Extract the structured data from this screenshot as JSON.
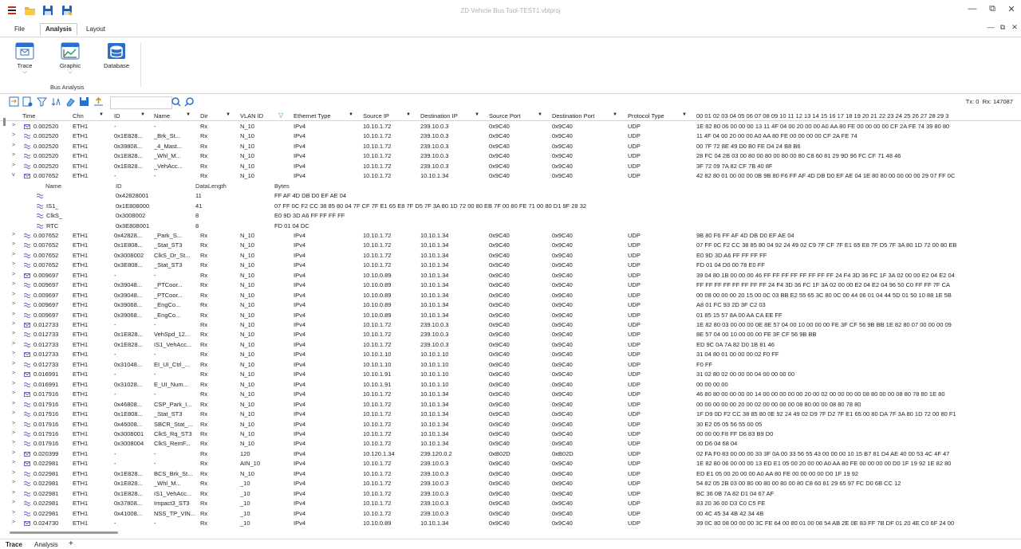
{
  "window": {
    "title": "ZD Vehicle Bus Tool-TEST1.vbtproj",
    "controls": [
      "—",
      "⧉",
      "✕"
    ],
    "doc_controls": [
      "—",
      "⧉",
      "✕"
    ]
  },
  "quick_access": [
    "app-logo-icon",
    "open-folder-icon",
    "save-icon",
    "save-as-icon"
  ],
  "menu": {
    "tabs": [
      "File",
      "Analysis",
      "Layout"
    ],
    "active": "Analysis"
  },
  "ribbon": {
    "buttons": [
      {
        "label": "Trace",
        "icon": "trace-window-icon",
        "has_dropdown": true
      },
      {
        "label": "Graphic",
        "icon": "graphic-chart-icon",
        "has_dropdown": true
      },
      {
        "label": "Database",
        "icon": "database-icon",
        "has_dropdown": false
      }
    ],
    "group_label": "Bus Analysis"
  },
  "toolbar": {
    "icons": [
      "export-icon",
      "import-icon",
      "filter-icon",
      "sort-icon",
      "clear-icon",
      "save-trace-icon",
      "upload-icon"
    ],
    "search_placeholder": "",
    "search_icons": [
      "search-next-icon",
      "search-prev-icon"
    ],
    "tx_label": "Tx: 0",
    "rx_label": "Rx: 147087"
  },
  "columns": [
    "Time",
    "Chn",
    "ID",
    "Name",
    "Dir",
    "VLAN ID",
    "Ethernet Type",
    "Source IP",
    "Destination IP",
    "Source Port",
    "Destination Port",
    "Protocol Type",
    "00 01 02 03 04 05 06 07 08 09 10 11 12 13 14 15 16 17 18 19 20 21 22 23 24 25 26 27 28 29 3"
  ],
  "rows_before": [
    {
      "exp": ">",
      "type": "mail",
      "time": "0.002520",
      "chn": "ETH1",
      "id": "-",
      "name": "-",
      "dir": "Rx",
      "vlan": "N_10",
      "eth": "IPv4",
      "src": "10.10.1.72",
      "dst": "239.10.0.3",
      "sport": "0x9C40",
      "dport": "0x9C40",
      "proto": "UDP",
      "bytes": "1E 82 80 06 00 00 00 13 11 4F 04 00 20 00 00 A0 AA 80 FE 00 00 00 00 CF 2A FE 74 39 80 80"
    },
    {
      "exp": ">",
      "type": "wave",
      "time": "0.002520",
      "chn": "ETH1",
      "id": "0x1E828...",
      "name": "_Brk_St...",
      "dir": "Rx",
      "vlan": "N_10",
      "eth": "IPv4",
      "src": "10.10.1.72",
      "dst": "239.10.0.3",
      "sport": "0x9C40",
      "dport": "0x9C40",
      "proto": "UDP",
      "bytes": "11 4F 04 00 20 00 00 A0 AA 80 FE 00 00 00 00 CF 2A FE 74"
    },
    {
      "exp": ">",
      "type": "wave",
      "time": "0.002520",
      "chn": "ETH1",
      "id": "0x39808...",
      "name": "_4_Mast...",
      "dir": "Rx",
      "vlan": "N_10",
      "eth": "IPv4",
      "src": "10.10.1.72",
      "dst": "239.10.0.3",
      "sport": "0x9C40",
      "dport": "0x9C40",
      "proto": "UDP",
      "bytes": "00 7F 72 8E 49 D0 B0 FE D4 24 B8 B6"
    },
    {
      "exp": ">",
      "type": "wave",
      "time": "0.002520",
      "chn": "ETH1",
      "id": "0x1E828...",
      "name": "_Whl_M...",
      "dir": "Rx",
      "vlan": "N_10",
      "eth": "IPv4",
      "src": "10.10.1.72",
      "dst": "239.10.0.3",
      "sport": "0x9C40",
      "dport": "0x9C40",
      "proto": "UDP",
      "bytes": "28 FC 04 2B 03 00 80 00 80 00 80 00 80 C8 60 81 29 9D 96 FC CF 71 48 46"
    },
    {
      "exp": ">",
      "type": "wave",
      "time": "0.002520",
      "chn": "ETH1",
      "id": "0x1E828...",
      "name": "_VehAcc...",
      "dir": "Rx",
      "vlan": "N_10",
      "eth": "IPv4",
      "src": "10.10.1.72",
      "dst": "239.10.0.3",
      "sport": "0x9C40",
      "dport": "0x9C40",
      "proto": "UDP",
      "bytes": "3F 72 09 7A 82 CF 7B 40 8F"
    },
    {
      "exp": "v",
      "type": "mail",
      "time": "0.007652",
      "chn": "ETH1",
      "id": "-",
      "name": "-",
      "dir": "Rx",
      "vlan": "N_10",
      "eth": "IPv4",
      "src": "10.10.1.72",
      "dst": "10.10.1.34",
      "sport": "0x9C40",
      "dport": "0x9C40",
      "proto": "UDP",
      "bytes": "42 82 80 01 00 00 00 0B 9B 80 F6 FF AF 4D DB D0 EF AE 04 1E 80 80 00 00 00 00 29 07 FF 0C"
    }
  ],
  "sub_header": {
    "name": "Name",
    "id": "ID",
    "len": "DataLength",
    "bytes": "Bytes"
  },
  "sub_rows": [
    {
      "name": "",
      "id": "0x42828001",
      "len": "11",
      "bytes": "FF AF 4D DB D0 EF AE 04"
    },
    {
      "name": "IS1_",
      "id": "0x1E808000",
      "len": "41",
      "bytes": "07 FF 0C F2 CC 38 85 80 04  7F CF 7F E1 65 E8 7F D5 7F 3A 80 1D 72 00 80 EB 7F 00 80 FE 71 00 80 D1 9F 28 32"
    },
    {
      "name": "ClkS_",
      "id": "0x3008002",
      "len": "8",
      "bytes": "E0 9D 3D A6 FF FF FF FF"
    },
    {
      "name": "RTC",
      "id": "0x3E808001",
      "len": "8",
      "bytes": "FD 01 04 DC"
    }
  ],
  "rows_after": [
    {
      "exp": ">",
      "type": "wave",
      "time": "0.007652",
      "chn": "ETH1",
      "id": "0x42828...",
      "name": "_Park_S...",
      "dir": "Rx",
      "vlan": "N_10",
      "eth": "IPv4",
      "src": "10.10.1.72",
      "dst": "10.10.1.34",
      "sport": "0x9C40",
      "dport": "0x9C40",
      "proto": "UDP",
      "bytes": "9B 80 F6 FF AF 4D DB D0 EF AE 04"
    },
    {
      "exp": ">",
      "type": "wave",
      "time": "0.007652",
      "chn": "ETH1",
      "id": "0x1E808...",
      "name": "_Stat_ST3",
      "dir": "Rx",
      "vlan": "N_10",
      "eth": "IPv4",
      "src": "10.10.1.72",
      "dst": "10.10.1.34",
      "sport": "0x9C40",
      "dport": "0x9C40",
      "proto": "UDP",
      "bytes": "07 FF 0C F2 CC 38 85 80 04 92 24 49 02 C9 7F CF 7F E1 65 E8 7F D5 7F 3A 80 1D 72 00 80 EB"
    },
    {
      "exp": ">",
      "type": "wave",
      "time": "0.007652",
      "chn": "ETH1",
      "id": "0x3008002",
      "name": "ClkS_Dr_St...",
      "dir": "Rx",
      "vlan": "N_10",
      "eth": "IPv4",
      "src": "10.10.1.72",
      "dst": "10.10.1.34",
      "sport": "0x9C40",
      "dport": "0x9C40",
      "proto": "UDP",
      "bytes": "E0 9D 3D A6 FF FF FF FF"
    },
    {
      "exp": ">",
      "type": "wave",
      "time": "0.007652",
      "chn": "ETH1",
      "id": "0x3E808...",
      "name": "_Stat_ST3",
      "dir": "Rx",
      "vlan": "N_10",
      "eth": "IPv4",
      "src": "10.10.1.72",
      "dst": "10.10.1.34",
      "sport": "0x9C40",
      "dport": "0x9C40",
      "proto": "UDP",
      "bytes": "FD 01 04 D0 00 78 E0 FF"
    },
    {
      "exp": ">",
      "type": "mail",
      "time": "0.009697",
      "chn": "ETH1",
      "id": "-",
      "name": "-",
      "dir": "Rx",
      "vlan": "N_10",
      "eth": "IPv4",
      "src": "10.10.0.89",
      "dst": "10.10.1.34",
      "sport": "0x9C40",
      "dport": "0x9C40",
      "proto": "UDP",
      "bytes": "39 04 80 1B 00 00 00 46 FF FF FF FF FF FF FF FF 24 F4 3D 36 FC 1F 3A 02 00 00 E2 04 E2 04"
    },
    {
      "exp": ">",
      "type": "wave",
      "time": "0.009697",
      "chn": "ETH1",
      "id": "0x39048...",
      "name": "_PTCoor...",
      "dir": "Rx",
      "vlan": "N_10",
      "eth": "IPv4",
      "src": "10.10.0.89",
      "dst": "10.10.1.34",
      "sport": "0x9C40",
      "dport": "0x9C40",
      "proto": "UDP",
      "bytes": "FF FF FF FF FF FF FF FF 24 F4 3D 36 FC 1F 3A 02 00 00 E2 04 E2 04 96 50 C0 FF FF 7F CA"
    },
    {
      "exp": ">",
      "type": "wave",
      "time": "0.009697",
      "chn": "ETH1",
      "id": "0x39048...",
      "name": "_PTCoor...",
      "dir": "Rx",
      "vlan": "N_10",
      "eth": "IPv4",
      "src": "10.10.0.89",
      "dst": "10.10.1.34",
      "sport": "0x9C40",
      "dport": "0x9C40",
      "proto": "UDP",
      "bytes": "00 08 00 00 00 20 15 00 0C 03 BB E2 55 65 3C 80 0C 00 44 06 01 04 44 5D 01 50 10 88 1E 5B"
    },
    {
      "exp": ">",
      "type": "wave",
      "time": "0.009697",
      "chn": "ETH1",
      "id": "0x39068...",
      "name": "_EngCo...",
      "dir": "Rx",
      "vlan": "N_10",
      "eth": "IPv4",
      "src": "10.10.0.89",
      "dst": "10.10.1.34",
      "sport": "0x9C40",
      "dport": "0x9C40",
      "proto": "UDP",
      "bytes": "A8 01 FC 93 2D 3F C2 03"
    },
    {
      "exp": ">",
      "type": "wave",
      "time": "0.009697",
      "chn": "ETH1",
      "id": "0x39068...",
      "name": "_EngCo...",
      "dir": "Rx",
      "vlan": "N_10",
      "eth": "IPv4",
      "src": "10.10.0.89",
      "dst": "10.10.1.34",
      "sport": "0x9C40",
      "dport": "0x9C40",
      "proto": "UDP",
      "bytes": "01 85 15 57 8A 00 AA CA EE FF"
    },
    {
      "exp": ">",
      "type": "mail",
      "time": "0.012733",
      "chn": "ETH1",
      "id": "-",
      "name": "-",
      "dir": "Rx",
      "vlan": "N_10",
      "eth": "IPv4",
      "src": "10.10.1.72",
      "dst": "239.10.0.3",
      "sport": "0x9C40",
      "dport": "0x9C40",
      "proto": "UDP",
      "bytes": "1E 82 80 03 00 00 00 0E 8E 57 04 00 10 00 00 00 FE 3F CF 56 9B BB 1E 82 80 07 00 00 00 09"
    },
    {
      "exp": ">",
      "type": "wave",
      "time": "0.012733",
      "chn": "ETH1",
      "id": "0x1E828...",
      "name": "VehSpd_12...",
      "dir": "Rx",
      "vlan": "N_10",
      "eth": "IPv4",
      "src": "10.10.1.72",
      "dst": "239.10.0.3",
      "sport": "0x9C40",
      "dport": "0x9C40",
      "proto": "UDP",
      "bytes": "8E 57 04 00 10 00 00 00 FE 3F CF 56 9B BB"
    },
    {
      "exp": ">",
      "type": "wave",
      "time": "0.012733",
      "chn": "ETH1",
      "id": "0x1E828...",
      "name": "IS1_VehAcc...",
      "dir": "Rx",
      "vlan": "N_10",
      "eth": "IPv4",
      "src": "10.10.1.72",
      "dst": "239.10.0.3",
      "sport": "0x9C40",
      "dport": "0x9C40",
      "proto": "UDP",
      "bytes": "ED 9C 0A 7A 82 D0 1B 81 46"
    },
    {
      "exp": ">",
      "type": "mail",
      "time": "0.012733",
      "chn": "ETH1",
      "id": "-",
      "name": "-",
      "dir": "Rx",
      "vlan": "N_10",
      "eth": "IPv4",
      "src": "10.10.1.10",
      "dst": "10.10.1.10",
      "sport": "0x9C40",
      "dport": "0x9C40",
      "proto": "UDP",
      "bytes": "31 04 80 01 00 00 00 02 F0 FF"
    },
    {
      "exp": ">",
      "type": "wave",
      "time": "0.012733",
      "chn": "ETH1",
      "id": "0x31048...",
      "name": "EI_UI_Ctrl_...",
      "dir": "Rx",
      "vlan": "N_10",
      "eth": "IPv4",
      "src": "10.10.1.10",
      "dst": "10.10.1.10",
      "sport": "0x9C40",
      "dport": "0x9C40",
      "proto": "UDP",
      "bytes": "F0 FF"
    },
    {
      "exp": ">",
      "type": "mail",
      "time": "0.016991",
      "chn": "ETH1",
      "id": "-",
      "name": "-",
      "dir": "Rx",
      "vlan": "N_10",
      "eth": "IPv4",
      "src": "10.10.1.91",
      "dst": "10.10.1.10",
      "sport": "0x9C40",
      "dport": "0x9C40",
      "proto": "UDP",
      "bytes": "31 02 80 02 00 00 00 04 00 00 00 00"
    },
    {
      "exp": ">",
      "type": "wave",
      "time": "0.016991",
      "chn": "ETH1",
      "id": "0x31028...",
      "name": "E_UI_Num...",
      "dir": "Rx",
      "vlan": "N_10",
      "eth": "IPv4",
      "src": "10.10.1.91",
      "dst": "10.10.1.10",
      "sport": "0x9C40",
      "dport": "0x9C40",
      "proto": "UDP",
      "bytes": "00 00 00 00"
    },
    {
      "exp": ">",
      "type": "mail",
      "time": "0.017916",
      "chn": "ETH1",
      "id": "-",
      "name": "-",
      "dir": "Rx",
      "vlan": "N_10",
      "eth": "IPv4",
      "src": "10.10.1.72",
      "dst": "10.10.1.34",
      "sport": "0x9C40",
      "dport": "0x9C40",
      "proto": "UDP",
      "bytes": "46 80 80 00 00 00 00 14 00 00 00 00 00 20 00 02 00 00 00 00 08 80 00 00 08 80 78 80 1E 80"
    },
    {
      "exp": ">",
      "type": "wave",
      "time": "0.017916",
      "chn": "ETH1",
      "id": "0x46808...",
      "name": "CSP_Park_I...",
      "dir": "Rx",
      "vlan": "N_10",
      "eth": "IPv4",
      "src": "10.10.1.72",
      "dst": "10.10.1.34",
      "sport": "0x9C40",
      "dport": "0x9C40",
      "proto": "UDP",
      "bytes": "00 00 00 00 00 20 00 02 00 00 00 00 08 80 00 00 08 80 78 80"
    },
    {
      "exp": ">",
      "type": "wave",
      "time": "0.017916",
      "chn": "ETH1",
      "id": "0x1E808...",
      "name": "_Stat_ST3",
      "dir": "Rx",
      "vlan": "N_10",
      "eth": "IPv4",
      "src": "10.10.1.72",
      "dst": "10.10.1.34",
      "sport": "0x9C40",
      "dport": "0x9C40",
      "proto": "UDP",
      "bytes": "1F D9 0D F2 CC 38 85 80 0E 92 24 49 02 D9 7F D2 7F E1 65 00 80 DA 7F 3A 80 1D 72 00 80 F1"
    },
    {
      "exp": ">",
      "type": "wave",
      "time": "0.017916",
      "chn": "ETH1",
      "id": "0x46008...",
      "name": "SBCR_Stat_...",
      "dir": "Rx",
      "vlan": "N_10",
      "eth": "IPv4",
      "src": "10.10.1.72",
      "dst": "10.10.1.34",
      "sport": "0x9C40",
      "dport": "0x9C40",
      "proto": "UDP",
      "bytes": "30 E2 05 05 56 55 00 05"
    },
    {
      "exp": ">",
      "type": "wave",
      "time": "0.017916",
      "chn": "ETH1",
      "id": "0x3008001",
      "name": "ClkS_Rq_ST3",
      "dir": "Rx",
      "vlan": "N_10",
      "eth": "IPv4",
      "src": "10.10.1.72",
      "dst": "10.10.1.34",
      "sport": "0x9C40",
      "dport": "0x9C40",
      "proto": "UDP",
      "bytes": "00 00 00 F8 FF D6 83 B9 D0"
    },
    {
      "exp": ">",
      "type": "wave",
      "time": "0.017916",
      "chn": "ETH1",
      "id": "0x3008004",
      "name": "ClkS_RemF...",
      "dir": "Rx",
      "vlan": "N_10",
      "eth": "IPv4",
      "src": "10.10.1.72",
      "dst": "10.10.1.34",
      "sport": "0x9C40",
      "dport": "0x9C40",
      "proto": "UDP",
      "bytes": "00 D6 04 68 04"
    },
    {
      "exp": ">",
      "type": "mail",
      "time": "0.020399",
      "chn": "ETH1",
      "id": "-",
      "name": "-",
      "dir": "Rx",
      "vlan": "120",
      "eth": "IPv4",
      "src": "10.120.1.34",
      "dst": "239.120.0.2",
      "sport": "0xB02D",
      "dport": "0xB02D",
      "proto": "UDP",
      "bytes": "02 FA F0 83 00 00 00 33 3F 0A 00 33 56 55 43 00 00 00 10 15 B7 81 D4 AE 40 00 53 4C 4F 47"
    },
    {
      "exp": ">",
      "type": "mail",
      "time": "0.022981",
      "chn": "ETH1",
      "id": "-",
      "name": "-",
      "dir": "Rx",
      "vlan": "AIN_10",
      "eth": "IPv4",
      "src": "10.10.1.72",
      "dst": "239.10.0.3",
      "sport": "0x9C40",
      "dport": "0x9C40",
      "proto": "UDP",
      "bytes": "1E 82 80 06 00 00 00 13 ED E1 05 00 20 00 00 A0 AA 80 FE 00 00 00 00 D0 1F 19 92 1E 82 80"
    },
    {
      "exp": ">",
      "type": "wave",
      "time": "0.022981",
      "chn": "ETH1",
      "id": "0x1E828...",
      "name": "BCS_Brk_St...",
      "dir": "Rx",
      "vlan": "N_10",
      "eth": "IPv4",
      "src": "10.10.1.72",
      "dst": "239.10.0.3",
      "sport": "0x9C40",
      "dport": "0x9C40",
      "proto": "UDP",
      "bytes": "ED E1 05 00 20 00 00 A0 AA 80 FE 00 00 00 00 D0 1F 19 92"
    },
    {
      "exp": ">",
      "type": "wave",
      "time": "0.022981",
      "chn": "ETH1",
      "id": "0x1E828...",
      "name": "_Whl_M...",
      "dir": "Rx",
      "vlan": "_10",
      "eth": "IPv4",
      "src": "10.10.1.72",
      "dst": "239.10.0.3",
      "sport": "0x9C40",
      "dport": "0x9C40",
      "proto": "UDP",
      "bytes": "54 82 05 2B 03 00 80 00 80 00 80 00 80 C8 60 81 29 65 97 FC D0 6B CC 12"
    },
    {
      "exp": ">",
      "type": "wave",
      "time": "0.022981",
      "chn": "ETH1",
      "id": "0x1E828...",
      "name": "IS1_VehAcc...",
      "dir": "Rx",
      "vlan": "_10",
      "eth": "IPv4",
      "src": "10.10.1.72",
      "dst": "239.10.0.3",
      "sport": "0x9C40",
      "dport": "0x9C40",
      "proto": "UDP",
      "bytes": "BC 36 0B 7A 82 D1 04 67 AF"
    },
    {
      "exp": ">",
      "type": "wave",
      "time": "0.022981",
      "chn": "ETH1",
      "id": "0x37808...",
      "name": "Impact3_ST3",
      "dir": "Rx",
      "vlan": "_10",
      "eth": "IPv4",
      "src": "10.10.1.72",
      "dst": "239.10.0.3",
      "sport": "0x9C40",
      "dport": "0x9C40",
      "proto": "UDP",
      "bytes": "83 20 36 00 D3 C0 C5 FE"
    },
    {
      "exp": ">",
      "type": "wave",
      "time": "0.022981",
      "chn": "ETH1",
      "id": "0x41008...",
      "name": "NSS_TP_VIN...",
      "dir": "Rx",
      "vlan": "_10",
      "eth": "IPv4",
      "src": "10.10.1.72",
      "dst": "239.10.0.3",
      "sport": "0x9C40",
      "dport": "0x9C40",
      "proto": "UDP",
      "bytes": "00 4C 45 34 4B 42 34 4B"
    },
    {
      "exp": ">",
      "type": "mail",
      "time": "0.024730",
      "chn": "ETH1",
      "id": "-",
      "name": "-",
      "dir": "Rx",
      "vlan": "_10",
      "eth": "IPv4",
      "src": "10.10.0.89",
      "dst": "10.10.1.34",
      "sport": "0x9C40",
      "dport": "0x9C40",
      "proto": "UDP",
      "bytes": "39 0C 80 08 00 00 00 3C FE 64 00 80 01 00 08 54 AB 2E 0E 83 FF 7B DF 01 20 4E C0 6F 24 00"
    }
  ],
  "status_tabs": [
    "Trace",
    "Analysis",
    "+"
  ],
  "colors": {
    "accent": "#1f6fd1",
    "row_icon": "#7b5fc0",
    "header_line": "#d4d4d4"
  }
}
